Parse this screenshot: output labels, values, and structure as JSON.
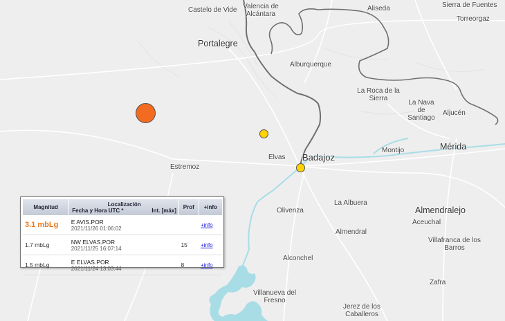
{
  "colors": {
    "land": "#eeeeee",
    "water": "#a8dde6",
    "border": "#707070",
    "roads": "#ffffff",
    "quake_large": "#f26b21",
    "quake_small": "#ffd200"
  },
  "map": {
    "places": {
      "castelo_de_vide": "Castelo de Vide",
      "valencia_de_alcantara": "Valencia de Alcántara",
      "aliseda": "Aliseda",
      "sierra_de_fuentes": "Sierra de Fuentes",
      "torreorgaz": "Torreorgaz",
      "portalegre": "Portalegre",
      "alburquerque": "Alburquerque",
      "la_roca_de_la_sierra": "La Roca de la Sierra",
      "la_nava_de_santiago": "La Nava de Santiago",
      "aljucen": "Aljucén",
      "elvas": "Elvas",
      "badajoz": "Badajoz",
      "montijo": "Montijo",
      "merida": "Mérida",
      "estremoz": "Estremoz",
      "olivenza": "Olivenza",
      "la_albuera": "La Albuera",
      "almendralejo": "Almendralejo",
      "aceuchal": "Aceuchal",
      "almendral": "Almendral",
      "villafranca_de_los_barros": "Villafranca de los Barros",
      "alconchel": "Alconchel",
      "zafra": "Zafra",
      "villanueva_del_fresno": "Villanueva del Fresno",
      "jerez_de_los_caballeros": "Jerez de los Caballeros"
    }
  },
  "legend": {
    "headers": {
      "magnitude": "Magnitud",
      "location": "Localización",
      "datetime": "Fecha y Hora UTC *",
      "intensity": "Int. [máx]",
      "depth": "Prof",
      "info": "+info"
    },
    "rows": [
      {
        "magnitude": "3.1 mbLg",
        "location": "E AVIS.POR",
        "datetime": "2021/11/26 01:06:02",
        "intensity": "",
        "depth": "",
        "info": "+info"
      },
      {
        "magnitude": "1.7 mbLg",
        "location": "NW ELVAS.POR",
        "datetime": "2021/11/25 16:07:14",
        "intensity": "",
        "depth": "15",
        "info": "+info"
      },
      {
        "magnitude": "1.5 mbLg",
        "location": "E ELVAS.POR",
        "datetime": "2021/11/24 13:03:44",
        "intensity": "",
        "depth": "8",
        "info": "+info"
      }
    ]
  }
}
